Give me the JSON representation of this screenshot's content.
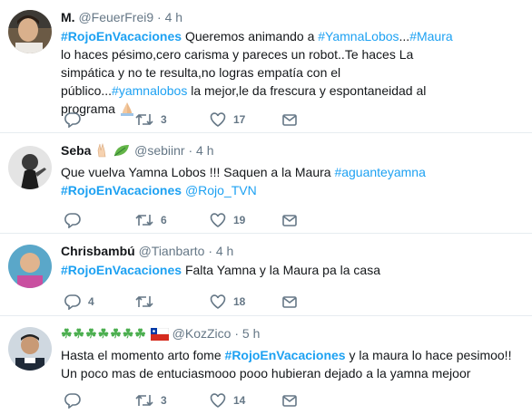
{
  "tweets": [
    {
      "name": "M.",
      "handle": "@FeuerFrei9",
      "time": "4 h",
      "text": [
        {
          "t": "#RojoEnVacaciones",
          "s": "tag b"
        },
        {
          "t": " Queremos animando a ",
          "s": ""
        },
        {
          "t": "#YamnaLobos",
          "s": "tag"
        },
        {
          "t": "...",
          "s": ""
        },
        {
          "t": "#Maura",
          "s": "tag"
        },
        {
          "t": " lo haces pésimo,cero carisma y pareces un robot..Te haces La simpática y no te resulta,no logras empatía con el público...",
          "s": ""
        },
        {
          "t": "#yamnalobos",
          "s": "tag"
        },
        {
          "t": " la mejor,le da frescura y espontaneidad al programa ",
          "s": ""
        }
      ],
      "replies": "",
      "retweets": "3",
      "likes": "17"
    },
    {
      "name": "Seba",
      "handle": "@sebiinr",
      "time": "4 h",
      "text": [
        {
          "t": "Que vuelva Yamna Lobos !!! Saquen a la Maura ",
          "s": ""
        },
        {
          "t": "#aguanteyamna",
          "s": "tag"
        },
        {
          "t": " ",
          "s": ""
        },
        {
          "t": "#RojoEnVacaciones",
          "s": "tag b"
        },
        {
          "t": " ",
          "s": ""
        },
        {
          "t": "@Rojo_TVN",
          "s": "tag"
        }
      ],
      "replies": "",
      "retweets": "6",
      "likes": "19"
    },
    {
      "name": "Chrisbambú",
      "handle": "@Tianbarto",
      "time": "4 h",
      "text": [
        {
          "t": "#RojoEnVacaciones",
          "s": "tag b"
        },
        {
          "t": " Falta Yamna y la Maura pa la casa",
          "s": ""
        }
      ],
      "replies": "4",
      "retweets": "",
      "likes": "18"
    },
    {
      "name": "☘☘☘☘☘☘☘",
      "handle": "@KozZico",
      "time": "5 h",
      "text": [
        {
          "t": "Hasta el momento arto fome ",
          "s": ""
        },
        {
          "t": "#RojoEnVacaciones",
          "s": "tag b"
        },
        {
          "t": " y la maura lo hace pesimoo!! Un poco mas de entuciasmooo pooo hubieran dejado a la yamna mejoor",
          "s": ""
        }
      ],
      "replies": "",
      "retweets": "3",
      "likes": "14"
    }
  ],
  "colors": {
    "link": "#1da1f2",
    "meta": "#657786",
    "text": "#14171a",
    "divider": "#e6ecf0",
    "clover": "#4caf50"
  },
  "icons": [
    "reply-icon",
    "retweet-icon",
    "like-icon",
    "message-icon",
    "praying-hands-emoji",
    "victory-hand-emoji",
    "leaf-emoji",
    "four-leaf-clover-emoji",
    "chile-flag-emoji"
  ]
}
